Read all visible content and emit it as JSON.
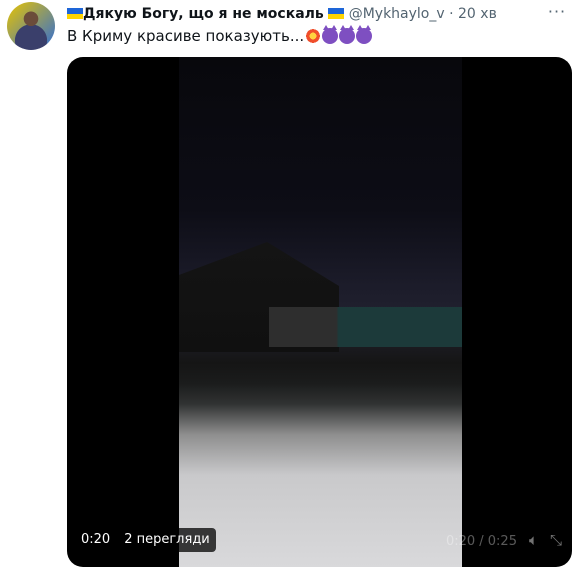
{
  "tweet": {
    "display_name": "Дякую Богу, що я не москаль",
    "handle": "@Mykhaylo_v",
    "separator": "·",
    "time": "20 хв",
    "text": "В Криму красиве показують...",
    "more_label": "···"
  },
  "video": {
    "elapsed": "0:20",
    "views": "2 перегляди",
    "time_label": "0:20 / 0:25",
    "volume_icon": "volume-icon",
    "fullscreen_icon": "fullscreen-icon"
  },
  "colors": {
    "flag_blue": "#1e66d8",
    "flag_yellow": "#ffd500",
    "devil_purple": "#7e4fc1"
  }
}
